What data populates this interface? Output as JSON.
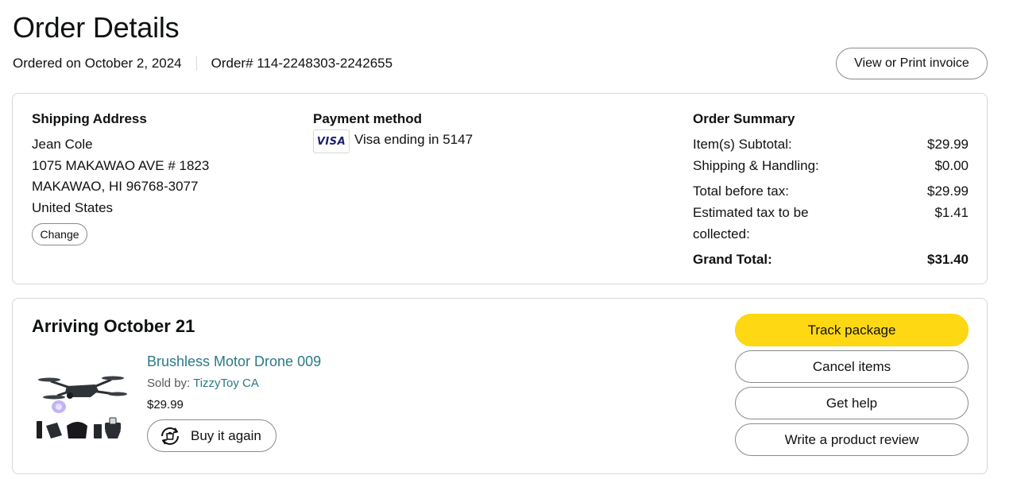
{
  "header": {
    "title": "Order Details",
    "ordered_on": "Ordered on October 2, 2024",
    "order_number": "Order# 114-2248303-2242655",
    "invoice_button": "View or Print invoice"
  },
  "shipping": {
    "heading": "Shipping Address",
    "name": "Jean Cole",
    "line1": "1075 MAKAWAO AVE # 1823",
    "line2": "MAKAWAO, HI 96768-3077",
    "country": "United States",
    "change_button": "Change"
  },
  "payment": {
    "heading": "Payment method",
    "card_brand": "VISA",
    "card_text": "Visa ending in 5147"
  },
  "summary": {
    "heading": "Order Summary",
    "rows": [
      {
        "label": "Item(s) Subtotal:",
        "value": "$29.99"
      },
      {
        "label": "Shipping & Handling:",
        "value": "$0.00"
      },
      {
        "label": "Total before tax:",
        "value": "$29.99"
      },
      {
        "label": "Estimated tax to be",
        "label_cont": "collected:",
        "value": "$1.41"
      },
      {
        "label": "Grand Total:",
        "value": "$31.40"
      }
    ]
  },
  "shipment": {
    "arriving": "Arriving October 21",
    "product_title": "Brushless Motor Drone 009",
    "sold_by_label": "Sold by: ",
    "seller": "TizzyToy CA",
    "price": "$29.99",
    "buy_again": "Buy it again",
    "actions": {
      "track": "Track package",
      "cancel": "Cancel items",
      "help": "Get help",
      "review": "Write a product review"
    }
  },
  "colors": {
    "primary_button": "#ffd814",
    "link": "#2a7a86",
    "border": "#d5d9d9",
    "visa": "#1a1f71"
  }
}
